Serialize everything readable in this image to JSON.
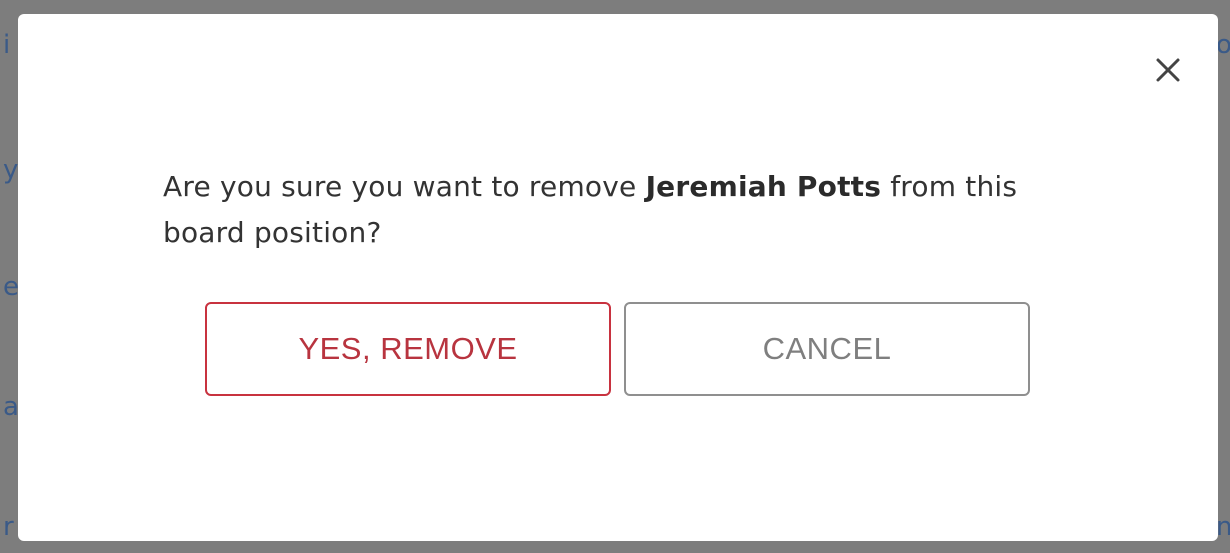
{
  "backdrop": {
    "fragments": [
      "i",
      "y",
      "e",
      "a",
      "r g",
      "o",
      "n"
    ]
  },
  "dialog": {
    "close_icon": "close-icon",
    "message_before": "Are you sure you want to remove ",
    "member_name": "Jeremiah Potts",
    "message_after": " from this board position?",
    "confirm_label": "YES, REMOVE",
    "cancel_label": "CANCEL"
  },
  "colors": {
    "overlay": "#7d7d7d",
    "danger": "#c8323f",
    "neutral_border": "#8f8f8f",
    "text": "#333333"
  }
}
